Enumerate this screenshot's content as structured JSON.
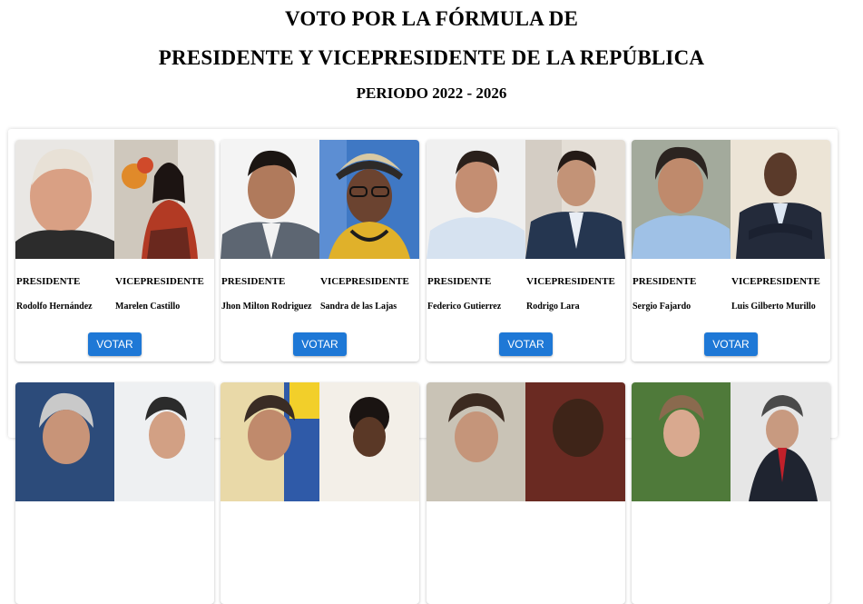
{
  "header": {
    "title_line1": "VOTO POR LA FÓRMULA DE",
    "title_line2": "PRESIDENTE Y VICEPRESIDENTE DE LA REPÚBLICA",
    "period": "PERIODO 2022 - 2026"
  },
  "labels": {
    "president": "PRESIDENTE",
    "vice_president": "VICEPRESIDENTE",
    "vote_button": "VOTAR"
  },
  "candidates": [
    {
      "president": "Rodolfo Hernández",
      "vice_president": "Marelen Castillo"
    },
    {
      "president": "Jhon Milton Rodriguez",
      "vice_president": "Sandra de las Lajas"
    },
    {
      "president": "Federico Gutierrez",
      "vice_president": "Rodrigo Lara"
    },
    {
      "president": "Sergio Fajardo",
      "vice_president": "Luis Gilberto Murillo"
    }
  ],
  "colors": {
    "vote_button_bg": "#1e78d6"
  }
}
